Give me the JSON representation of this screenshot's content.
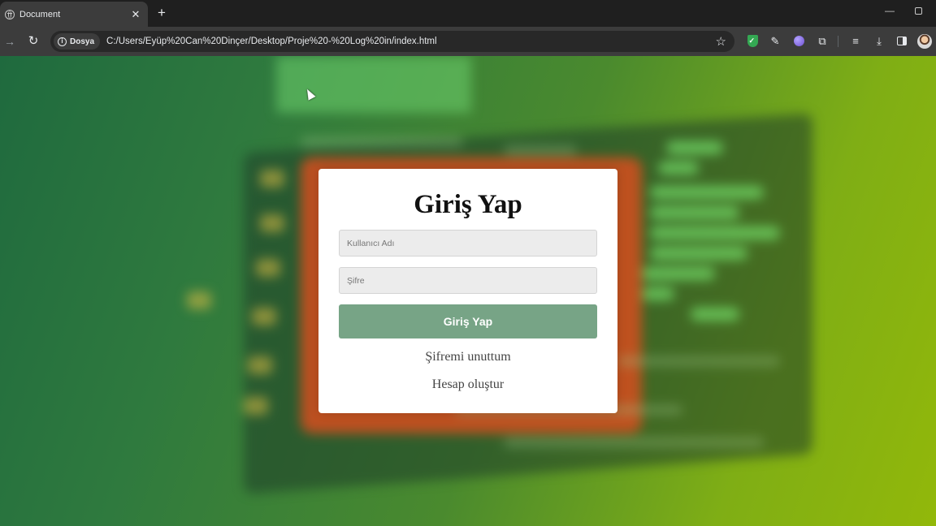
{
  "browser": {
    "tab_title": "Document",
    "tab_close": "✕",
    "new_tab": "+",
    "minimize": "—",
    "security_chip": "Dosya",
    "url": "C:/Users/Eyüp%20Can%20Dinçer/Desktop/Proje%20-%20Log%20in/index.html",
    "icons": [
      "back-arrow-icon",
      "reload-icon",
      "info-icon",
      "star-icon",
      "shield-extension-icon",
      "eyedropper-icon",
      "orb-extension-icon",
      "puzzle-icon",
      "media-queue-icon",
      "download-icon",
      "side-panel-icon",
      "profile-avatar"
    ]
  },
  "login": {
    "title": "Giriş Yap",
    "username_placeholder": "Kullanıcı Adı",
    "password_placeholder": "Şifre",
    "submit_label": "Giriş Yap",
    "forgot_link": "Şifremi unuttum",
    "register_link": "Hesap oluştur"
  },
  "colors": {
    "button": "#77a486",
    "card": "#ffffff",
    "background_start": "#1f6a3e",
    "background_end": "#92b80a",
    "glow": "#d64e1e"
  }
}
